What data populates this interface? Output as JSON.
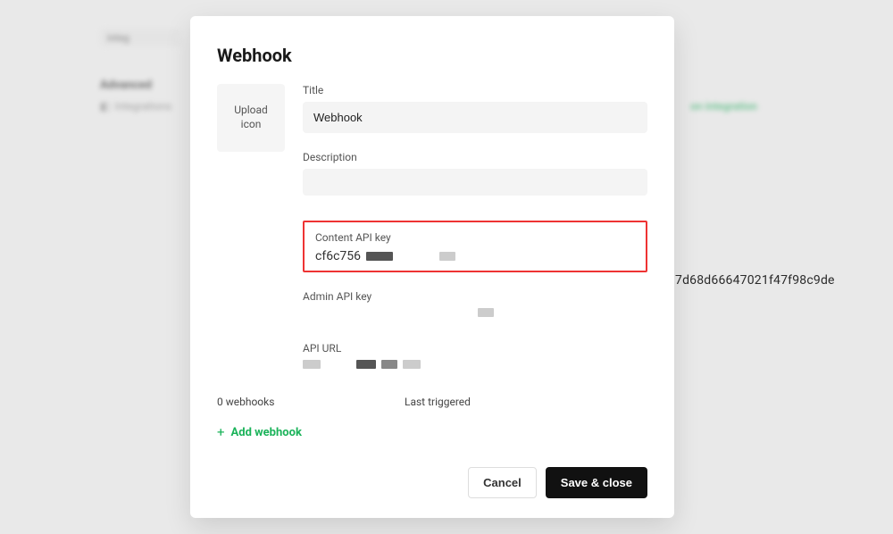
{
  "background": {
    "search_placeholder": "integ",
    "advanced_label": "Advanced",
    "integrations_label": "Integrations",
    "green_link": "on integration"
  },
  "modal": {
    "title": "Webhook",
    "upload_label_line1": "Upload",
    "upload_label_line2": "icon",
    "fields": {
      "title_label": "Title",
      "title_value": "Webhook",
      "description_label": "Description",
      "description_value": ""
    },
    "api": {
      "content_label": "Content API key",
      "content_value_prefix": "cf6c756",
      "admin_label": "Admin API key",
      "admin_value_overflow": "7d68d66647021f47f98c9de",
      "url_label": "API URL"
    },
    "webhooks": {
      "count_label": "0 webhooks",
      "last_triggered_label": "Last triggered",
      "add_label": "Add webhook"
    },
    "buttons": {
      "cancel": "Cancel",
      "save": "Save & close"
    }
  }
}
